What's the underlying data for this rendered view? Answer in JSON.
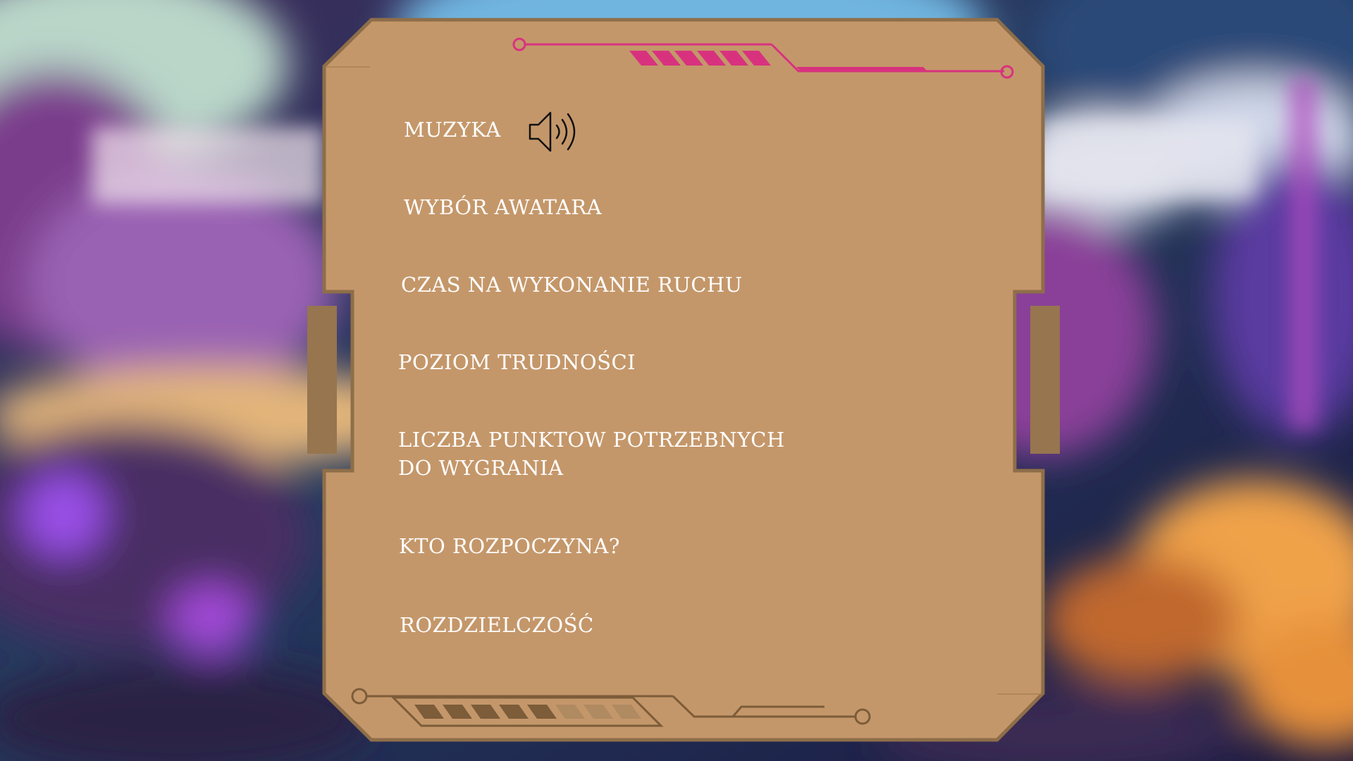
{
  "menu": {
    "items": [
      {
        "id": "music",
        "label": "MUZYKA"
      },
      {
        "id": "avatar",
        "label": "WYBÓR AWATARA"
      },
      {
        "id": "move-time",
        "label": "CZAS NA WYKONANIE RUCHU"
      },
      {
        "id": "difficulty",
        "label": "POZIOM TRUDNOŚCI"
      },
      {
        "id": "points-line1",
        "label": "LICZBA PUNKTOW POTRZEBNYCH"
      },
      {
        "id": "points-line2",
        "label": "DO WYGRANIA"
      },
      {
        "id": "who-starts",
        "label": "KTO ROZPOCZYNA?"
      },
      {
        "id": "resolution",
        "label": "ROZDZIELCZOŚĆ"
      }
    ]
  },
  "music_toggle": {
    "icon": "speaker-volume-icon",
    "state": "on"
  },
  "colors": {
    "panel": "#c4976a",
    "panel_border": "#8e6e49",
    "accent_pink": "#d8327f",
    "accent_brown": "#7c5c39",
    "text": "#ffffff"
  }
}
